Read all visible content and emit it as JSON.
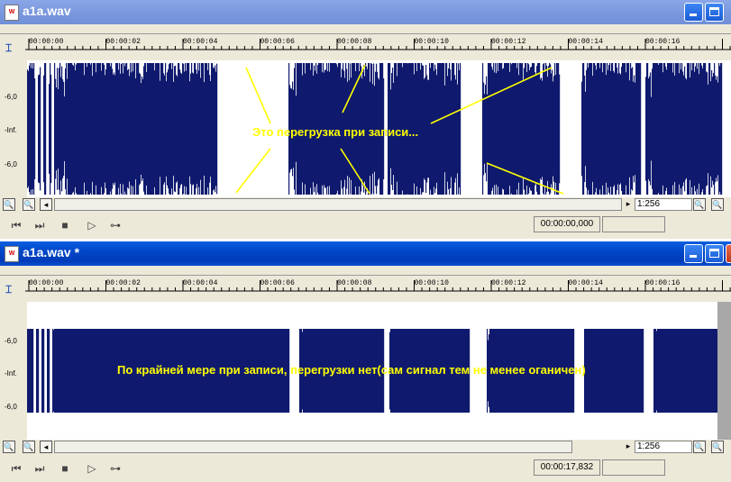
{
  "top_window": {
    "title": "a1a.wav",
    "time_ticks": [
      "00:00:00",
      "00:00:02",
      "00:00:04",
      "00:00:06",
      "00:00:08",
      "00:00:10",
      "00:00:12",
      "00:00:14",
      "00:00:16"
    ],
    "level_labels": [
      "-6,0",
      "-Inf.",
      "-6,0"
    ],
    "annotation": "Это перегрузка при записи...",
    "zoom": "1:256",
    "time_display": "00:00:00,000"
  },
  "bottom_window": {
    "title": "a1a.wav *",
    "time_ticks": [
      "00:00:00",
      "00:00:02",
      "00:00:04",
      "00:00:06",
      "00:00:08",
      "00:00:10",
      "00:00:12",
      "00:00:14",
      "00:00:16"
    ],
    "level_labels": [
      "-6,0",
      "-Inf.",
      "-6,0"
    ],
    "annotation": "По крайней мере при записи, перегрузки нет(сам сигнал тем не менее оганичен)",
    "zoom": "1:256",
    "time_display": "00:00:17,832"
  },
  "icons": {
    "app": "wave-file-icon",
    "ruler": "cursor-marker-icon",
    "zoom_out": "zoom-out-icon",
    "zoom_in": "zoom-in-icon",
    "scroll_left": "arrow-left-icon",
    "scroll_right": "arrow-right-icon",
    "go_start": "go-to-start-icon",
    "go_end": "go-to-end-icon",
    "stop": "stop-icon",
    "play": "play-icon",
    "loop": "loop-icon"
  },
  "colors": {
    "waveform": "#0f1a6e",
    "annotation": "#ffff00",
    "titlebar": "#0046c8"
  }
}
